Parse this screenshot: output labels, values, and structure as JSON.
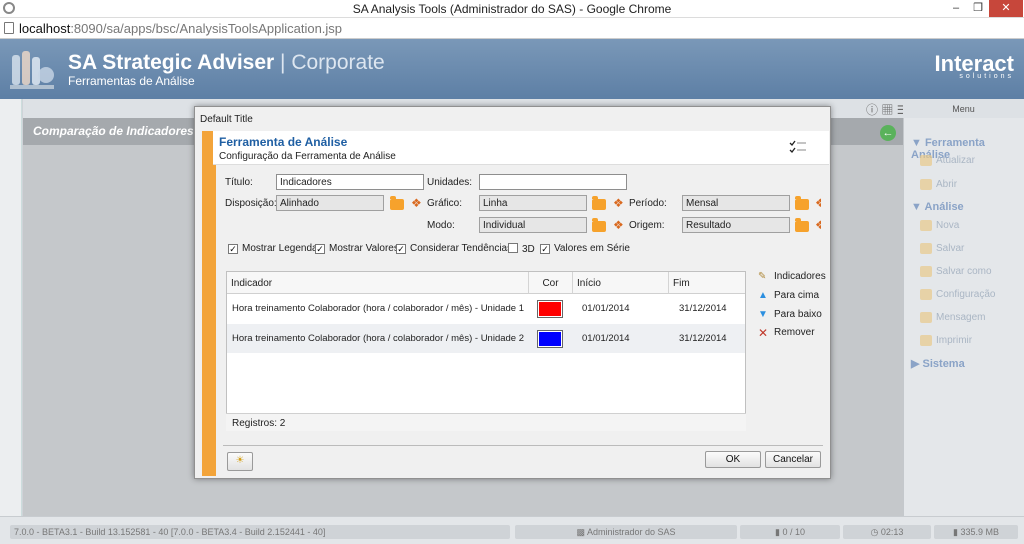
{
  "window": {
    "title": "SA Analysis Tools (Administrador do SAS) - Google Chrome",
    "minimize": "–",
    "maximize": "❒",
    "close": "✕"
  },
  "address": {
    "host": "localhost",
    "rest": ":8090/sa/apps/bsc/AnalysisToolsApplication.jsp"
  },
  "banner": {
    "title": "SA Strategic Adviser",
    "title_suffix": "| Corporate",
    "subtitle": "Ferramentas de Análise",
    "brand": "Interact",
    "brand_sub": "solutions"
  },
  "panel": {
    "title": "Comparação de Indicadores"
  },
  "menu": {
    "header": "Menu",
    "sections": [
      {
        "label": "Ferramenta Análise",
        "items": [
          "Atualizar",
          "Abrir"
        ]
      },
      {
        "label": "Análise",
        "items": [
          "Nova",
          "Salvar",
          "Salvar como",
          "Configuração",
          "Mensagem",
          "Imprimir"
        ]
      },
      {
        "label": "Sistema",
        "items": []
      }
    ]
  },
  "statusbar": {
    "version": "7.0.0 - BETA3.1 - Build 13.152581 - 40 [7.0.0 - BETA3.4 - Build 2.152441 - 40]",
    "user": "Administrador do SAS",
    "counter": "0 / 10",
    "time": "02:13",
    "memory": "335.9 MB"
  },
  "dialog": {
    "window_title": "Default Title",
    "header_title": "Ferramenta de Análise",
    "header_subtitle": "Configuração da Ferramenta de Análise",
    "fields": {
      "titulo_label": "Título:",
      "titulo_value": "Indicadores",
      "unidades_label": "Unidades:",
      "unidades_value": "",
      "disposicao_label": "Disposição:",
      "disposicao_value": "Alinhado",
      "grafico_label": "Gráfico:",
      "grafico_value": "Linha",
      "periodo_label": "Período:",
      "periodo_value": "Mensal",
      "modo_label": "Modo:",
      "modo_value": "Individual",
      "origem_label": "Origem:",
      "origem_value": "Resultado"
    },
    "options": [
      {
        "label": "Mostrar Legenda",
        "checked": true
      },
      {
        "label": "Mostrar Valores",
        "checked": true
      },
      {
        "label": "Considerar Tendências",
        "checked": true
      },
      {
        "label": "3D",
        "checked": false
      },
      {
        "label": "Valores em Série",
        "checked": true
      }
    ],
    "table": {
      "columns": [
        "Indicador",
        "Cor",
        "Início",
        "Fim"
      ],
      "rows": [
        {
          "indicador": "Hora treinamento Colaborador (hora / colaborador / mês) - Unidade 1",
          "cor": "#ff0000",
          "inicio": "01/01/2014",
          "fim": "31/12/2014"
        },
        {
          "indicador": "Hora treinamento Colaborador (hora / colaborador / mês) - Unidade 2",
          "cor": "#0000ff",
          "inicio": "01/01/2014",
          "fim": "31/12/2014"
        }
      ],
      "footer": "Registros: 2"
    },
    "actions": [
      "Indicadores",
      "Para cima",
      "Para baixo",
      "Remover"
    ],
    "ok_label": "OK",
    "cancel_label": "Cancelar"
  }
}
